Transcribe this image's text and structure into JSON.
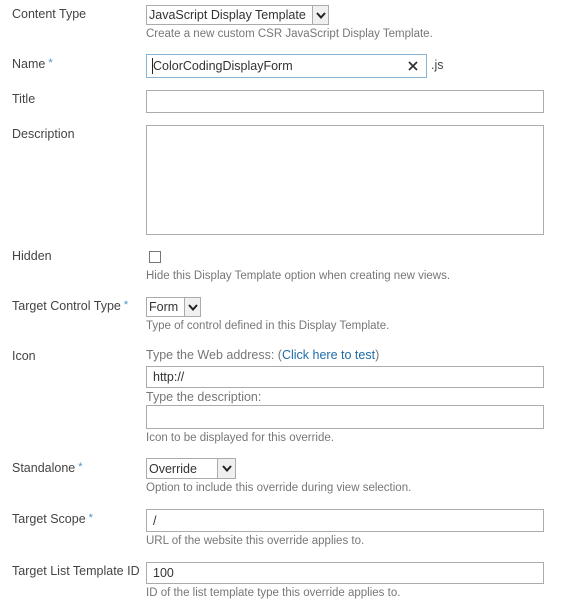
{
  "form": {
    "content_type": {
      "label": "Content Type",
      "value": "JavaScript Display Template",
      "hint": "Create a new custom CSR JavaScript Display Template."
    },
    "name": {
      "label": "Name",
      "required_mark": "*",
      "value": "ColorCodingDisplayForm",
      "suffix": ".js",
      "clear_icon": "close-icon"
    },
    "title": {
      "label": "Title",
      "value": ""
    },
    "description": {
      "label": "Description",
      "value": ""
    },
    "hidden": {
      "label": "Hidden",
      "checked": false,
      "hint": "Hide this Display Template option when creating new views."
    },
    "target_control_type": {
      "label": "Target Control Type",
      "required_mark": "*",
      "value": "Form",
      "hint": "Type of control defined in this Display Template."
    },
    "icon": {
      "label": "Icon",
      "url_prompt": "Type the Web address: ",
      "test_link_open": "(",
      "test_link": "Click here to test",
      "test_link_close": ")",
      "url_value": "http://",
      "desc_prompt": "Type the description:",
      "desc_value": "",
      "hint": "Icon to be displayed for this override."
    },
    "standalone": {
      "label": "Standalone",
      "required_mark": "*",
      "value": "Override",
      "hint": "Option to include this override during view selection."
    },
    "target_scope": {
      "label": "Target Scope",
      "required_mark": "*",
      "value": "/",
      "hint": "URL of the website this override applies to."
    },
    "target_list_template_id": {
      "label": "Target List Template ID",
      "value": "100",
      "hint": "ID of the list template type this override applies to."
    }
  },
  "colors": {
    "link": "#1f6ca8",
    "required": "#4a8fc0",
    "border": "#ababab",
    "focus_border": "#88b3d3",
    "hint_text": "#777777",
    "label_text": "#444444"
  }
}
